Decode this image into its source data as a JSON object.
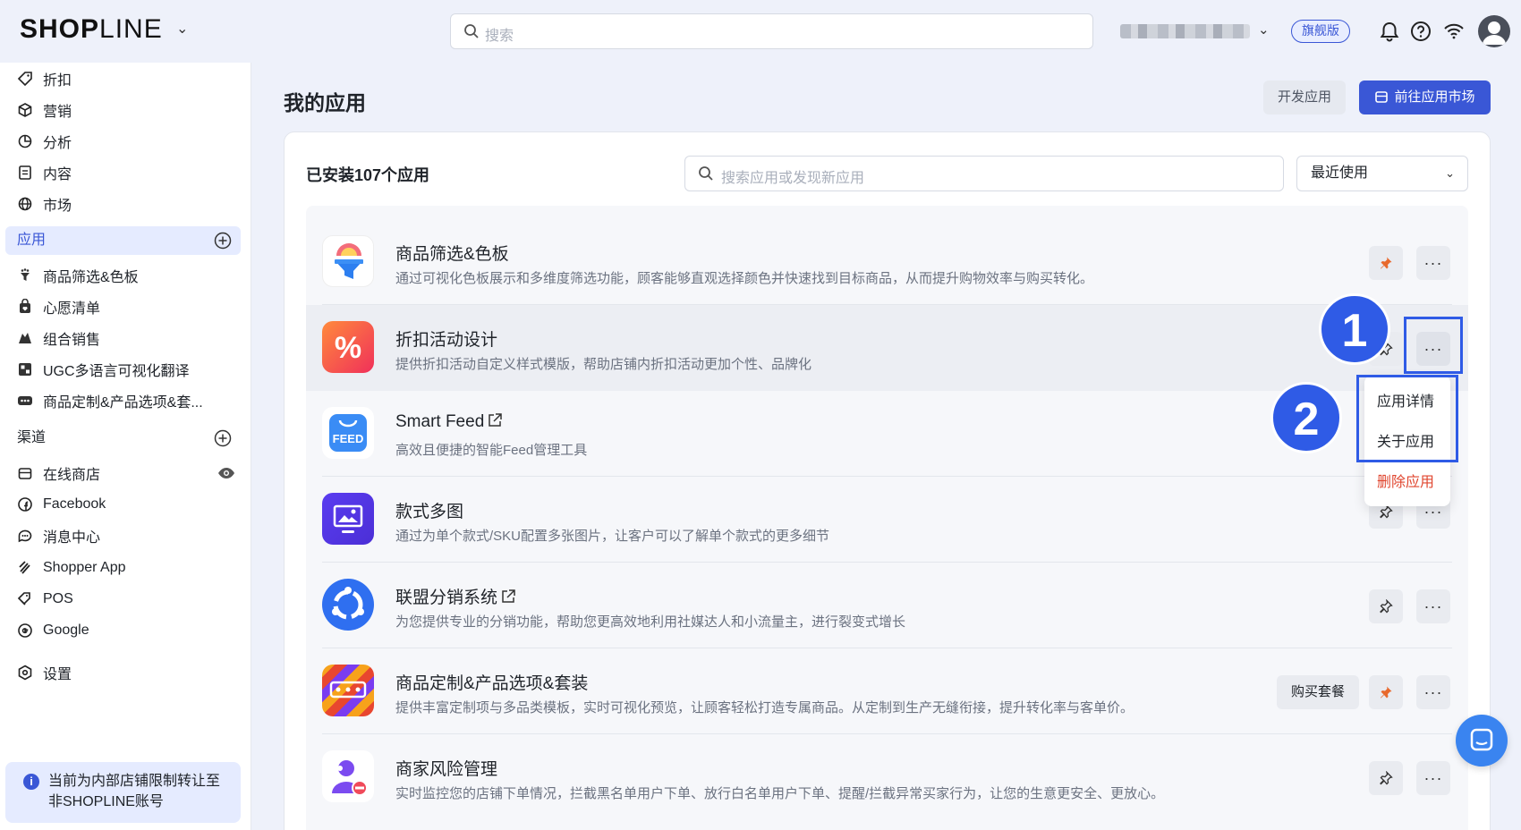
{
  "topbar": {
    "logo_bold": "SHOP",
    "logo_light": "LINE",
    "search_placeholder": "搜索",
    "plan_badge": "旗舰版",
    "icons": [
      "bell-icon",
      "help-icon",
      "wifi-icon",
      "avatar"
    ]
  },
  "sidebar": {
    "top_items": [
      {
        "label": "折扣",
        "icon": "tag-icon"
      },
      {
        "label": "营销",
        "icon": "cube-icon"
      },
      {
        "label": "分析",
        "icon": "pie-icon"
      },
      {
        "label": "内容",
        "icon": "document-icon"
      },
      {
        "label": "市场",
        "icon": "globe-icon"
      }
    ],
    "apps_section": "应用",
    "app_items": [
      {
        "label": "商品筛选&色板",
        "icon": "filter-app-icon"
      },
      {
        "label": "心愿清单",
        "icon": "wishlist-icon"
      },
      {
        "label": "组合销售",
        "icon": "bundle-icon"
      },
      {
        "label": "UGC多语言可视化翻译",
        "icon": "translate-icon"
      },
      {
        "label": "商品定制&产品选项&套...",
        "icon": "custom-icon"
      }
    ],
    "channels_section": "渠道",
    "channel_items": [
      {
        "label": "在线商店",
        "icon": "store-icon"
      },
      {
        "label": "Facebook",
        "icon": "facebook-icon"
      },
      {
        "label": "消息中心",
        "icon": "message-icon"
      },
      {
        "label": "Shopper App",
        "icon": "shopper-icon"
      },
      {
        "label": "POS",
        "icon": "pos-icon"
      },
      {
        "label": "Google",
        "icon": "google-icon"
      }
    ],
    "settings": "设置",
    "notice": "当前为内部店铺限制转让至非SHOPLINE账号"
  },
  "main": {
    "title": "我的应用",
    "dev_button": "开发应用",
    "market_button": "前往应用市场",
    "installed_count": "已安装107个应用",
    "app_search_placeholder": "搜索应用或发现新应用",
    "sort_value": "最近使用",
    "apps": [
      {
        "name": "商品筛选&色板",
        "desc": "通过可视化色板展示和多维度筛选功能，顾客能够直观选择颜色并快速找到目标商品，从而提升购物效率与购买转化。",
        "pinned": true
      },
      {
        "name": "折扣活动设计",
        "desc": "提供折扣活动自定义样式模版，帮助店铺内折扣活动更加个性、品牌化",
        "pinned": false
      },
      {
        "name": "Smart Feed",
        "desc": "高效且便捷的智能Feed管理工具",
        "pinned": false
      },
      {
        "name": "款式多图",
        "desc": "通过为单个款式/SKU配置多张图片，让客户可以了解单个款式的更多细节",
        "pinned": false
      },
      {
        "name": "联盟分销系统",
        "desc": "为您提供专业的分销功能，帮助您更高效地利用社媒达人和小流量主，进行裂变式增长",
        "pinned": false
      },
      {
        "name": "商品定制&产品选项&套装",
        "desc": "提供丰富定制项与多品类模板，实时可视化预览，让顾客轻松打造专属商品。从定制到生产无缝衔接，提升转化率与客单价。",
        "pinned": true,
        "extra_button": "购买套餐"
      },
      {
        "name": "商家风险管理",
        "desc": "实时监控您的店铺下单情况，拦截黑名单用户下单、放行白名单用户下单、提醒/拦截异常买家行为，让您的生意更安全、更放心。",
        "pinned": false
      }
    ],
    "more_label": "···",
    "menu": {
      "details": "应用详情",
      "about": "关于应用",
      "delete": "删除应用"
    },
    "callouts": [
      "1",
      "2"
    ]
  },
  "colors": {
    "accent": "#3a57d6",
    "highlight_box": "#2f5be6",
    "danger": "#e0462f",
    "pin_active": "#e8692c"
  }
}
